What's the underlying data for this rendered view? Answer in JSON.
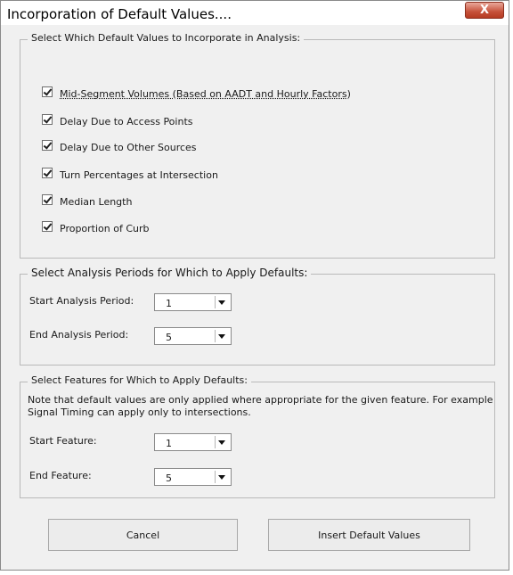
{
  "window": {
    "title": "Incorporation of Default Values....",
    "close_glyph": "X"
  },
  "defaults_group": {
    "legend": "Select Which Default Values to Incorporate in Analysis:",
    "items": [
      {
        "label": "Mid-Segment Volumes (Based on AADT and Hourly Factors)",
        "checked": true
      },
      {
        "label": "Delay Due to Access Points",
        "checked": true
      },
      {
        "label": "Delay Due to Other Sources",
        "checked": true
      },
      {
        "label": "Turn Percentages at Intersection",
        "checked": true
      },
      {
        "label": "Median Length",
        "checked": true
      },
      {
        "label": "Proportion of Curb",
        "checked": true
      }
    ]
  },
  "periods_group": {
    "legend": "Select Analysis Periods for Which to Apply Defaults:",
    "start_label": "Start Analysis Period:",
    "start_value": "1",
    "end_label": "End Analysis Period:",
    "end_value": "5"
  },
  "features_group": {
    "legend": "Select Features for Which to Apply Defaults:",
    "note": "Note that default values are only applied where appropriate for the given feature. For example Signal Timing can apply only to intersections.",
    "start_label": "Start Feature:",
    "start_value": "1",
    "end_label": "End Feature:",
    "end_value": "5"
  },
  "buttons": {
    "cancel": "Cancel",
    "insert": "Insert Default Values"
  }
}
